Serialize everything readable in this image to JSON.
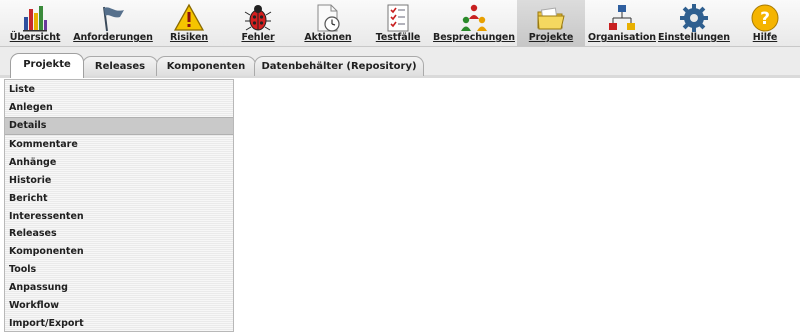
{
  "toolbar": {
    "items": [
      {
        "label": "Übersicht",
        "icon": "bar-chart-icon"
      },
      {
        "label": "Anforderungen",
        "icon": "flag-icon"
      },
      {
        "label": "Risiken",
        "icon": "warning-icon"
      },
      {
        "label": "Fehler",
        "icon": "bug-icon"
      },
      {
        "label": "Aktionen",
        "icon": "clock-document-icon"
      },
      {
        "label": "Testfälle",
        "icon": "checklist-icon"
      },
      {
        "label": "Besprechungen",
        "icon": "people-icon"
      },
      {
        "label": "Projekte",
        "icon": "folder-icon",
        "active": true
      },
      {
        "label": "Organisation",
        "icon": "org-chart-icon"
      },
      {
        "label": "Einstellungen",
        "icon": "gear-icon"
      },
      {
        "label": "Hilfe",
        "icon": "help-icon"
      }
    ]
  },
  "tabs": [
    {
      "label": "Projekte",
      "active": true
    },
    {
      "label": "Releases"
    },
    {
      "label": "Komponenten"
    },
    {
      "label": "Datenbehälter (Repository)"
    }
  ],
  "sidebar": {
    "items": [
      {
        "label": "Liste"
      },
      {
        "label": "Anlegen"
      },
      {
        "label": "Details",
        "active": true
      },
      {
        "label": "Kommentare"
      },
      {
        "label": "Anhänge"
      },
      {
        "label": "Historie"
      },
      {
        "label": "Bericht"
      },
      {
        "label": "Interessenten"
      },
      {
        "label": "Releases"
      },
      {
        "label": "Komponenten"
      },
      {
        "label": "Tools"
      },
      {
        "label": "Anpassung"
      },
      {
        "label": "Workflow"
      },
      {
        "label": "Import/Export"
      }
    ]
  },
  "colors": {
    "active_toolbar_bg": "#cfcfcf",
    "active_sidebar_bg": "#c9c9c9",
    "warning_yellow": "#f5c400",
    "bug_red": "#d42020",
    "help_yellow": "#f5b400",
    "gear_blue": "#2f5f8f"
  }
}
